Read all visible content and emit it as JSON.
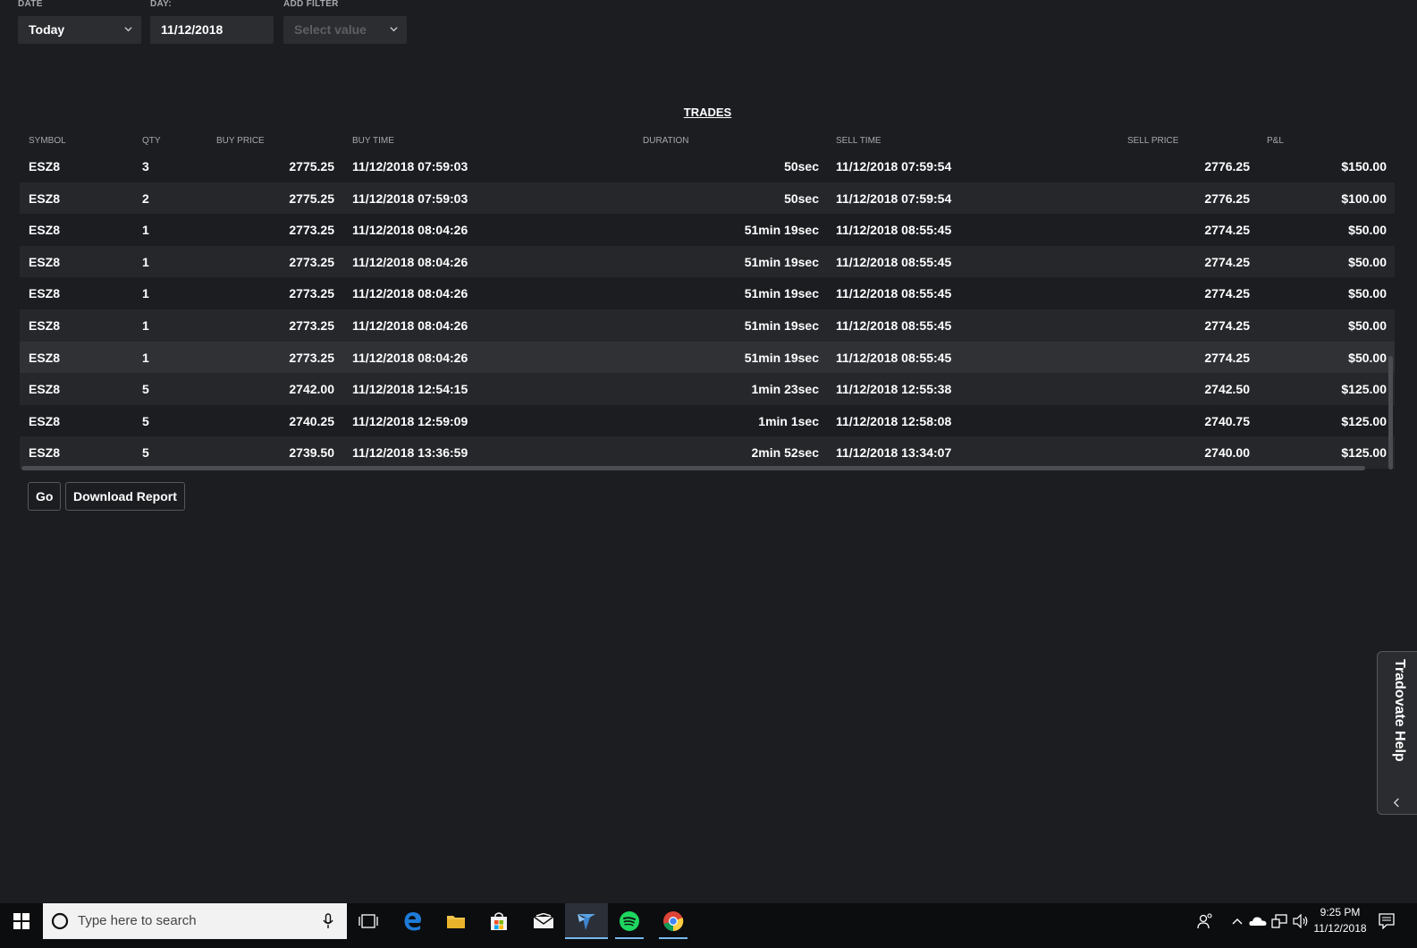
{
  "filters": {
    "date_label": "DATE",
    "date_value": "Today",
    "day_label": "DAY:",
    "day_value": "11/12/2018",
    "add_filter_label": "ADD FILTER",
    "add_filter_placeholder": "Select value"
  },
  "trades": {
    "title": "TRADES",
    "columns": [
      "SYMBOL",
      "QTY",
      "BUY PRICE",
      "BUY TIME",
      "DURATION",
      "SELL TIME",
      "SELL PRICE",
      "P&L"
    ],
    "rows": [
      [
        "ESZ8",
        "3",
        "2775.25",
        "11/12/2018 07:59:03",
        "50sec",
        "11/12/2018 07:59:54",
        "2776.25",
        "$150.00"
      ],
      [
        "ESZ8",
        "2",
        "2775.25",
        "11/12/2018 07:59:03",
        "50sec",
        "11/12/2018 07:59:54",
        "2776.25",
        "$100.00"
      ],
      [
        "ESZ8",
        "1",
        "2773.25",
        "11/12/2018 08:04:26",
        "51min 19sec",
        "11/12/2018 08:55:45",
        "2774.25",
        "$50.00"
      ],
      [
        "ESZ8",
        "1",
        "2773.25",
        "11/12/2018 08:04:26",
        "51min 19sec",
        "11/12/2018 08:55:45",
        "2774.25",
        "$50.00"
      ],
      [
        "ESZ8",
        "1",
        "2773.25",
        "11/12/2018 08:04:26",
        "51min 19sec",
        "11/12/2018 08:55:45",
        "2774.25",
        "$50.00"
      ],
      [
        "ESZ8",
        "1",
        "2773.25",
        "11/12/2018 08:04:26",
        "51min 19sec",
        "11/12/2018 08:55:45",
        "2774.25",
        "$50.00"
      ],
      [
        "ESZ8",
        "1",
        "2773.25",
        "11/12/2018 08:04:26",
        "51min 19sec",
        "11/12/2018 08:55:45",
        "2774.25",
        "$50.00"
      ],
      [
        "ESZ8",
        "5",
        "2742.00",
        "11/12/2018 12:54:15",
        "1min 23sec",
        "11/12/2018 12:55:38",
        "2742.50",
        "$125.00"
      ],
      [
        "ESZ8",
        "5",
        "2740.25",
        "11/12/2018 12:59:09",
        "1min 1sec",
        "11/12/2018 12:58:08",
        "2740.75",
        "$125.00"
      ],
      [
        "ESZ8",
        "5",
        "2739.50",
        "11/12/2018 13:36:59",
        "2min 52sec",
        "11/12/2018 13:34:07",
        "2740.00",
        "$125.00"
      ]
    ]
  },
  "actions": {
    "go_label": "Go",
    "download_label": "Download Report"
  },
  "help": {
    "label": "Tradovate Help"
  },
  "taskbar": {
    "search_placeholder": "Type here to search",
    "time": "9:25 PM",
    "date": "11/12/2018",
    "icons": [
      "windows-start-icon",
      "cortana-icon",
      "microphone-icon",
      "task-view-icon",
      "edge-icon",
      "file-explorer-icon",
      "store-icon",
      "mail-icon",
      "tradovate-icon",
      "spotify-icon",
      "chrome-icon",
      "people-icon",
      "tray-chevron-icon",
      "onedrive-icon",
      "network-icon",
      "volume-icon",
      "notifications-icon"
    ]
  },
  "colors": {
    "background": "#1b1d21",
    "row_alt": "#25272b",
    "row_hover": "#2f3135",
    "header_text": "#a6a8ad",
    "taskbar": "#0c0d0f"
  }
}
